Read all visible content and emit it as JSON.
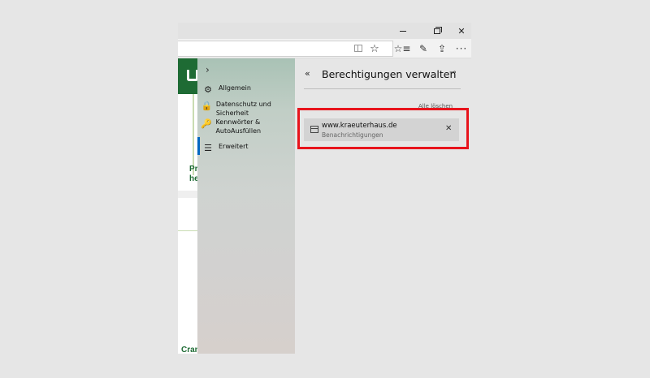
{
  "window": {
    "controls": {
      "minimize": "",
      "maximize": "",
      "close": "✕"
    }
  },
  "toolbar": {
    "reading_view_icon": "reading-view-icon",
    "favorite_icon": "☆",
    "favorites_icon": "☆≡",
    "pen_icon": "✎",
    "share_icon": "⇪",
    "more_icon": "···"
  },
  "page_content": {
    "promo_text": "Pr he",
    "footer_text": "Cran"
  },
  "settings_nav": {
    "expand_icon": "›",
    "items": [
      {
        "icon": "⚙",
        "label": "Allgemein"
      },
      {
        "icon": "🔒",
        "label": "Datenschutz und Sicherheit"
      },
      {
        "icon": "🔑",
        "label": "Kennwörter & AutoAusfüllen"
      },
      {
        "icon": "☰",
        "label": "Erweitert"
      }
    ],
    "active_index": 3
  },
  "permissions_panel": {
    "back_icon": "«",
    "title": "Berechtigungen verwalten",
    "pin_icon": "⊸",
    "clear_all": "Alle löschen",
    "sites": [
      {
        "name": "www.kraeuterhaus.de",
        "permission": "Benachrichtigungen",
        "remove_icon": "✕"
      }
    ]
  },
  "colors": {
    "highlight": "#e8141c",
    "accent": "#0067c0",
    "brand_green": "#1e6b34"
  }
}
